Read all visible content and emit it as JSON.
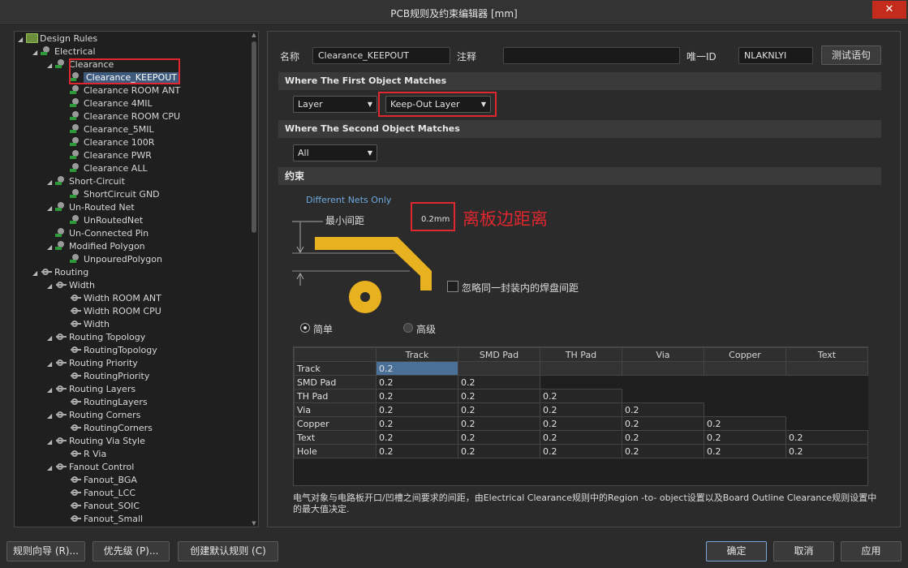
{
  "window": {
    "title": "PCB规则及约束编辑器 [mm]",
    "close": "✕"
  },
  "tree": {
    "root": "Design Rules",
    "electrical": "Electrical",
    "clearance": "Clearance",
    "clearance_items": [
      "Clearance_KEEPOUT",
      "Clearance ROOM ANT",
      "Clearance 4MIL",
      "Clearance ROOM CPU",
      "Clearance_5MIL",
      "Clearance 100R",
      "Clearance PWR",
      "Clearance ALL"
    ],
    "short_circuit": "Short-Circuit",
    "short_circuit_item": "ShortCircuit GND",
    "unrouted": "Un-Routed Net",
    "unrouted_item": "UnRoutedNet",
    "unconnected": "Un-Connected Pin",
    "modified_polygon": "Modified Polygon",
    "modified_polygon_item": "UnpouredPolygon",
    "routing": "Routing",
    "width": "Width",
    "width_items": [
      "Width ROOM ANT",
      "Width ROOM CPU",
      "Width"
    ],
    "topology": "Routing Topology",
    "topology_item": "RoutingTopology",
    "priority": "Routing Priority",
    "priority_item": "RoutingPriority",
    "layers": "Routing Layers",
    "layers_item": "RoutingLayers",
    "corners": "Routing Corners",
    "corners_item": "RoutingCorners",
    "via_style": "Routing Via Style",
    "via_style_item": "R Via",
    "fanout": "Fanout Control",
    "fanout_items": [
      "Fanout_BGA",
      "Fanout_LCC",
      "Fanout_SOIC",
      "Fanout_Small"
    ]
  },
  "form": {
    "name_label": "名称",
    "name_value": "Clearance_KEEPOUT",
    "comment_label": "注释",
    "comment_value": "",
    "uid_label": "唯一ID",
    "uid_value": "NLAKNLYI",
    "test_button": "测试语句"
  },
  "first_match": {
    "header": "Where The First Object Matches",
    "combo1": "Layer",
    "combo2": "Keep-Out Layer"
  },
  "second_match": {
    "header": "Where The Second Object Matches",
    "combo1": "All"
  },
  "constraints": {
    "header": "约束",
    "nets_label": "Different Nets Only",
    "min_clearance_label": "最小间距",
    "min_clearance_value": "0.2mm",
    "annotation": "离板边距离",
    "annotation_color": "#e0272f",
    "ignore_pads_label": "忽略同一封装内的焊盘间距",
    "ignore_pads_checked": false,
    "mode_simple": "简单",
    "mode_advanced": "高级",
    "selected_mode": "simple",
    "track_color": "#e8b11f"
  },
  "grid": {
    "columns": [
      "",
      "Track",
      "SMD Pad",
      "TH Pad",
      "Via",
      "Copper",
      "Text"
    ],
    "rows": [
      {
        "label": "Track",
        "values": [
          "0.2",
          "",
          "",
          "",
          "",
          ""
        ]
      },
      {
        "label": "SMD Pad",
        "values": [
          "0.2",
          "0.2",
          "",
          "",
          "",
          ""
        ]
      },
      {
        "label": "TH Pad",
        "values": [
          "0.2",
          "0.2",
          "0.2",
          "",
          "",
          ""
        ]
      },
      {
        "label": "Via",
        "values": [
          "0.2",
          "0.2",
          "0.2",
          "0.2",
          "",
          ""
        ]
      },
      {
        "label": "Copper",
        "values": [
          "0.2",
          "0.2",
          "0.2",
          "0.2",
          "0.2",
          ""
        ]
      },
      {
        "label": "Text",
        "values": [
          "0.2",
          "0.2",
          "0.2",
          "0.2",
          "0.2",
          "0.2"
        ]
      },
      {
        "label": "Hole",
        "values": [
          "0.2",
          "0.2",
          "0.2",
          "0.2",
          "0.2",
          "0.2"
        ]
      }
    ]
  },
  "description": "电气对象与电路板开口/凹槽之间要求的间距，由Electrical Clearance规则中的Region -to- object设置以及Board Outline Clearance规则设置中的最大值决定.",
  "buttons": {
    "rule_wizard": "规则向导 (R)...",
    "priorities": "优先级 (P)...",
    "create_default": "创建默认规则 (C)",
    "ok": "确定",
    "cancel": "取消",
    "apply": "应用"
  }
}
